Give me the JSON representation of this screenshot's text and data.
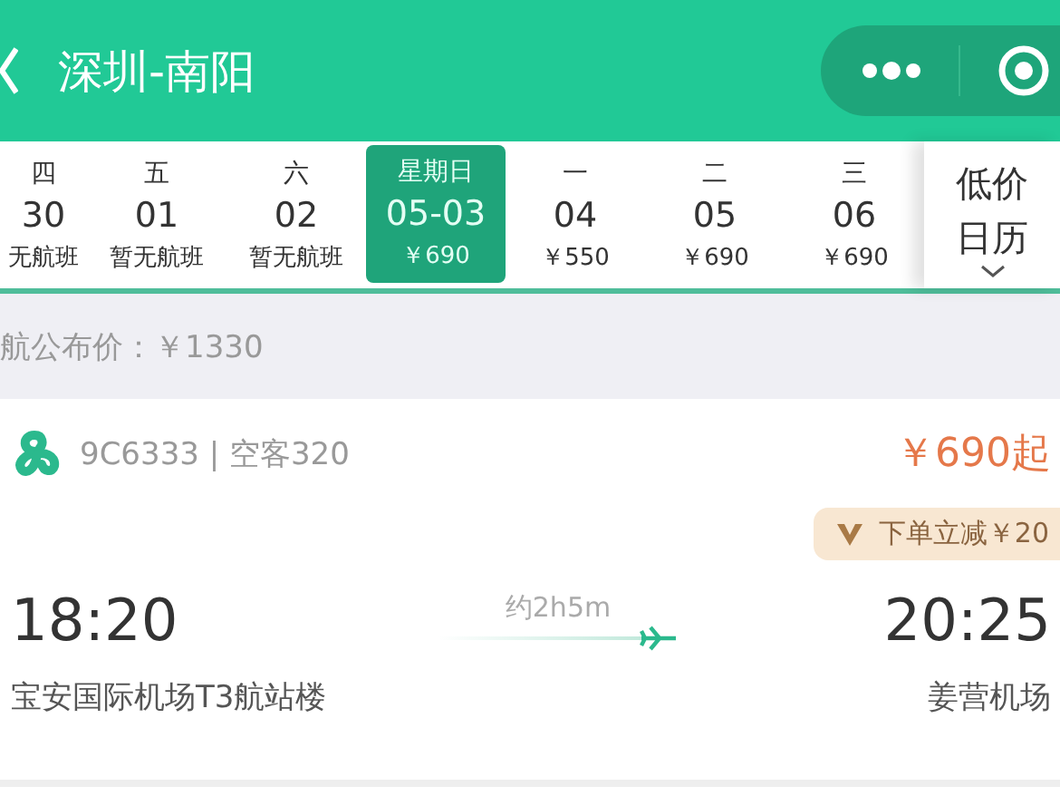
{
  "header": {
    "title": "深圳-南阳"
  },
  "dates": [
    {
      "weekday": "四",
      "day": "30",
      "price": "无航班",
      "selected": false
    },
    {
      "weekday": "五",
      "day": "01",
      "price": "暂无航班",
      "selected": false
    },
    {
      "weekday": "六",
      "day": "02",
      "price": "暂无航班",
      "selected": false
    },
    {
      "weekday": "星期日",
      "day": "05-03",
      "price": "￥690",
      "selected": true
    },
    {
      "weekday": "一",
      "day": "04",
      "price": "￥550",
      "selected": false
    },
    {
      "weekday": "二",
      "day": "05",
      "price": "￥690",
      "selected": false
    },
    {
      "weekday": "三",
      "day": "06",
      "price": "￥690",
      "selected": false
    }
  ],
  "calendar_button": {
    "line_1": "低价",
    "line_2": "日历"
  },
  "official_price": "航公布价：￥1330",
  "flight": {
    "number": "9C6333 | 空客320",
    "price": "￥690起",
    "discount": "下单立减￥20",
    "depart_time": "18:20",
    "duration": "约2h5m",
    "arrive_time": "20:25",
    "depart_airport": "宝安国际机场T3航站楼",
    "arrive_airport": "姜营机场"
  }
}
